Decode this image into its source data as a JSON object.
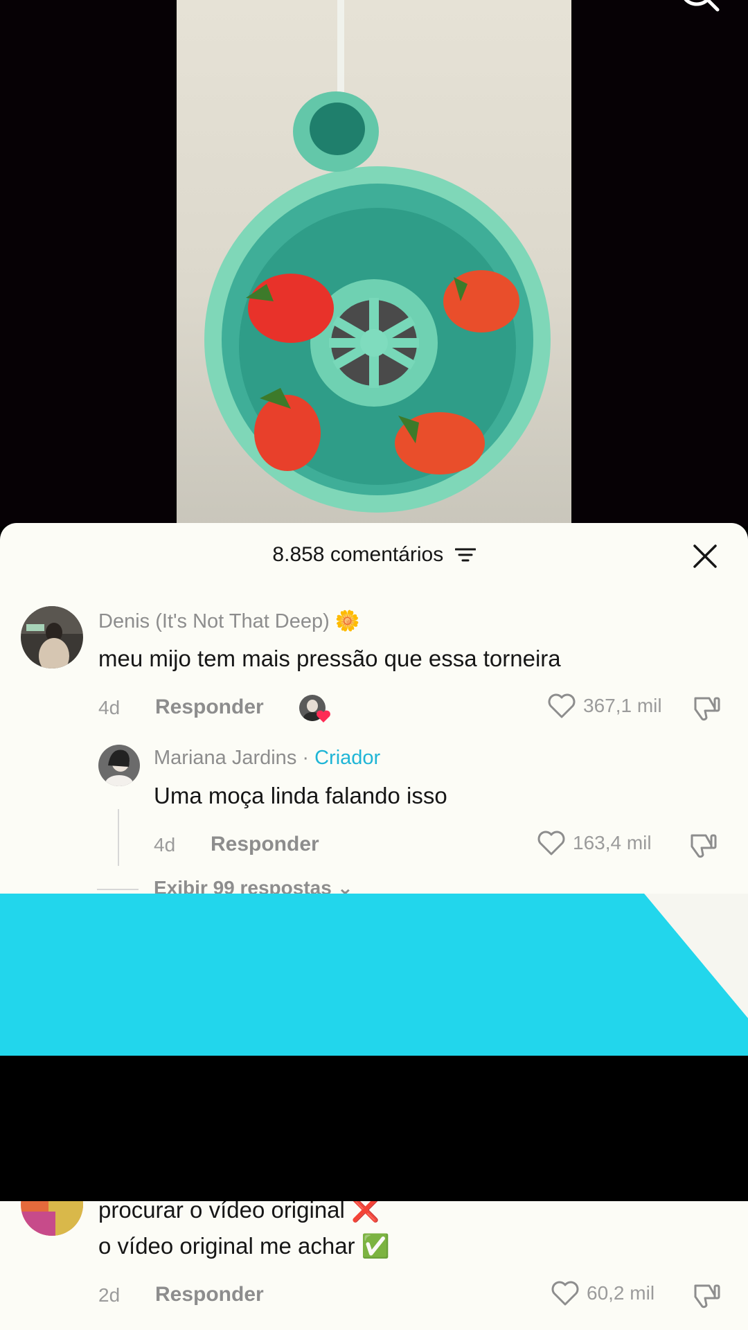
{
  "comments_panel": {
    "title": "8.858 comentários",
    "close_label": "×"
  },
  "comments": [
    {
      "username": "Denis (It's Not That Deep)",
      "badge": "🌼",
      "text": "meu mijo tem mais pressão que essa torneira",
      "age": "4d",
      "reply_label": "Responder",
      "likes": "367,1 mil"
    }
  ],
  "reply": {
    "username": "Mariana Jardins",
    "separator": " · ",
    "creator_label": "Criador",
    "text": "Uma moça linda falando isso",
    "age": "4d",
    "reply_label": "Responder",
    "likes": "163,4 mil",
    "view_replies": "Exibir 99 respostas"
  },
  "bottom_comment": {
    "line1": "procurar o vídeo original ❌",
    "line2": "o vídeo original me achar ✅",
    "age": "2d",
    "reply_label": "Responder",
    "likes": "60,2 mil"
  },
  "colors": {
    "accent_creator": "#1fb5d6",
    "overlay_cyan": "#22d6ec",
    "liked_heart": "#fe2c55"
  }
}
